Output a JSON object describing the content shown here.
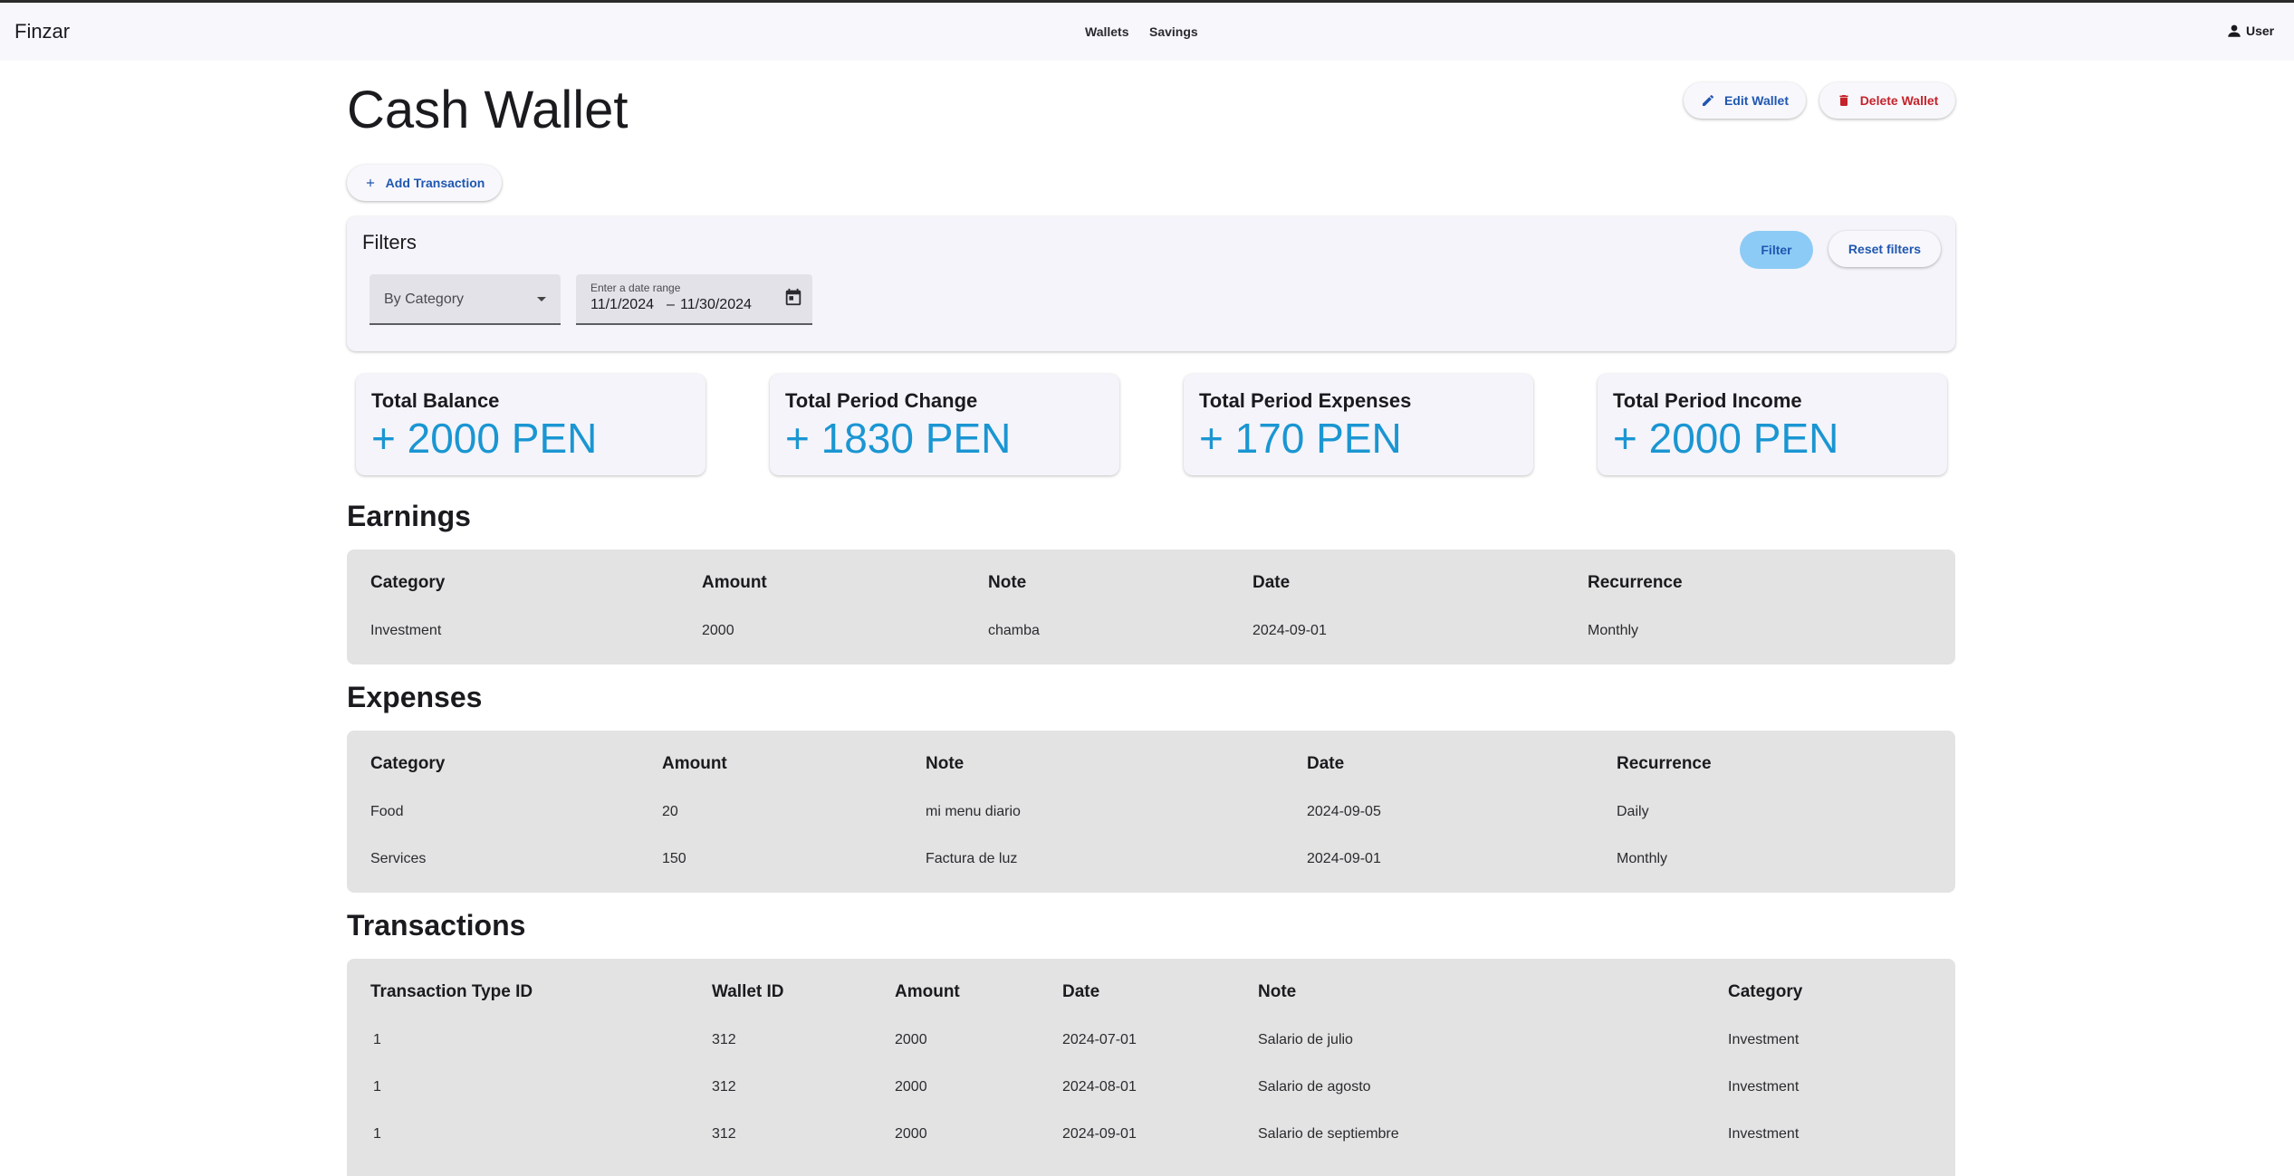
{
  "app": {
    "brand": "Finzar"
  },
  "nav": {
    "wallets": "Wallets",
    "savings": "Savings",
    "user": "User"
  },
  "page": {
    "title": "Cash Wallet"
  },
  "actions": {
    "edit": "Edit Wallet",
    "delete": "Delete Wallet",
    "add_transaction": "Add Transaction"
  },
  "filters": {
    "title": "Filters",
    "filter_label": "Filter",
    "reset_label": "Reset filters",
    "category_value": "By Category",
    "date_label": "Enter a date range",
    "date_start": "11/1/2024",
    "date_sep": "–",
    "date_end": "11/30/2024"
  },
  "stats": [
    {
      "label": "Total Balance",
      "value": "+ 2000 PEN"
    },
    {
      "label": "Total Period Change",
      "value": "+ 1830 PEN"
    },
    {
      "label": "Total Period Expenses",
      "value": "+ 170 PEN"
    },
    {
      "label": "Total Period Income",
      "value": "+ 2000 PEN"
    }
  ],
  "earnings": {
    "title": "Earnings",
    "headers": [
      "Category",
      "Amount",
      "Note",
      "Date",
      "Recurrence"
    ],
    "rows": [
      [
        "Investment",
        "2000",
        "chamba",
        "2024-09-01",
        "Monthly"
      ]
    ]
  },
  "expenses": {
    "title": "Expenses",
    "headers": [
      "Category",
      "Amount",
      "Note",
      "Date",
      "Recurrence"
    ],
    "rows": [
      [
        "Food",
        "20",
        "mi menu diario",
        "2024-09-05",
        "Daily"
      ],
      [
        "Services",
        "150",
        "Factura de luz",
        "2024-09-01",
        "Monthly"
      ]
    ]
  },
  "transactions": {
    "title": "Transactions",
    "headers": [
      "Transaction Type ID",
      "Wallet ID",
      "Amount",
      "Date",
      "Note",
      "Category"
    ],
    "rows": [
      [
        "1",
        "312",
        "2000",
        "2024-07-01",
        "Salario de julio",
        "Investment"
      ],
      [
        "1",
        "312",
        "2000",
        "2024-08-01",
        "Salario de agosto",
        "Investment"
      ],
      [
        "1",
        "312",
        "2000",
        "2024-09-01",
        "Salario de septiembre",
        "Investment"
      ]
    ]
  },
  "colors": {
    "accent": "#1a96d2",
    "primary": "#1f57b0",
    "danger": "#c4232a",
    "table_bg": "#e3e3e3"
  }
}
